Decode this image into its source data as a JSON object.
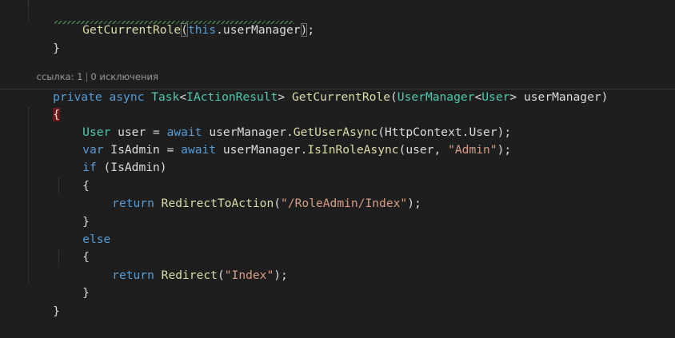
{
  "code_top": {
    "call_name": "GetCurrentRole",
    "open_paren": "(",
    "this_kw": "this",
    "dot_member": ".userManager",
    "close_paren": ")",
    "semicolon": ";",
    "closing_brace": "}"
  },
  "codelens": {
    "refs": "ссылка: 1",
    "exceptions": "0 исключения"
  },
  "signature": {
    "private_kw": "private",
    "async_kw": "async",
    "task_type": "Task",
    "lt": "<",
    "iaction_type": "IActionResult",
    "gt": ">",
    "method_name": "GetCurrentRole",
    "paren_open": "(",
    "usermanager_type": "UserManager",
    "lt2": "<",
    "user_type": "User",
    "gt2": ">",
    "param_name": " userManager)"
  },
  "body": {
    "open_brace": "{",
    "line1": {
      "type": "User",
      "rest1": " user = ",
      "await_kw": "await",
      "obj": " userManager.",
      "method": "GetUserAsync",
      "rest2": "(HttpContext.User);"
    },
    "line2": {
      "var_kw": "var",
      "rest1": " IsAdmin = ",
      "await_kw": "await",
      "obj": " userManager.",
      "method": "IsInRoleAsync",
      "rest2": "(user, ",
      "str": "\"Admin\"",
      "rest3": ");"
    },
    "line3": {
      "if_kw": "if",
      "rest": " (IsAdmin)"
    },
    "line4": "{",
    "line5": {
      "return_kw": "return",
      "method": " RedirectToAction",
      "open": "(",
      "str": "\"/RoleAdmin/Index\"",
      "close": ");"
    },
    "line6": "}",
    "line7": "else",
    "line8": "{",
    "line9": {
      "return_kw": "return",
      "method": " Redirect",
      "open": "(",
      "str": "\"Index\"",
      "close": ");"
    },
    "line10": "}",
    "close_brace": "}"
  },
  "colors": {
    "background": "#1e1e1e",
    "keyword": "#569cd6",
    "type": "#4ec9b0",
    "method": "#dcdcaa",
    "string": "#d69d85",
    "plain": "#dcdcdc"
  }
}
